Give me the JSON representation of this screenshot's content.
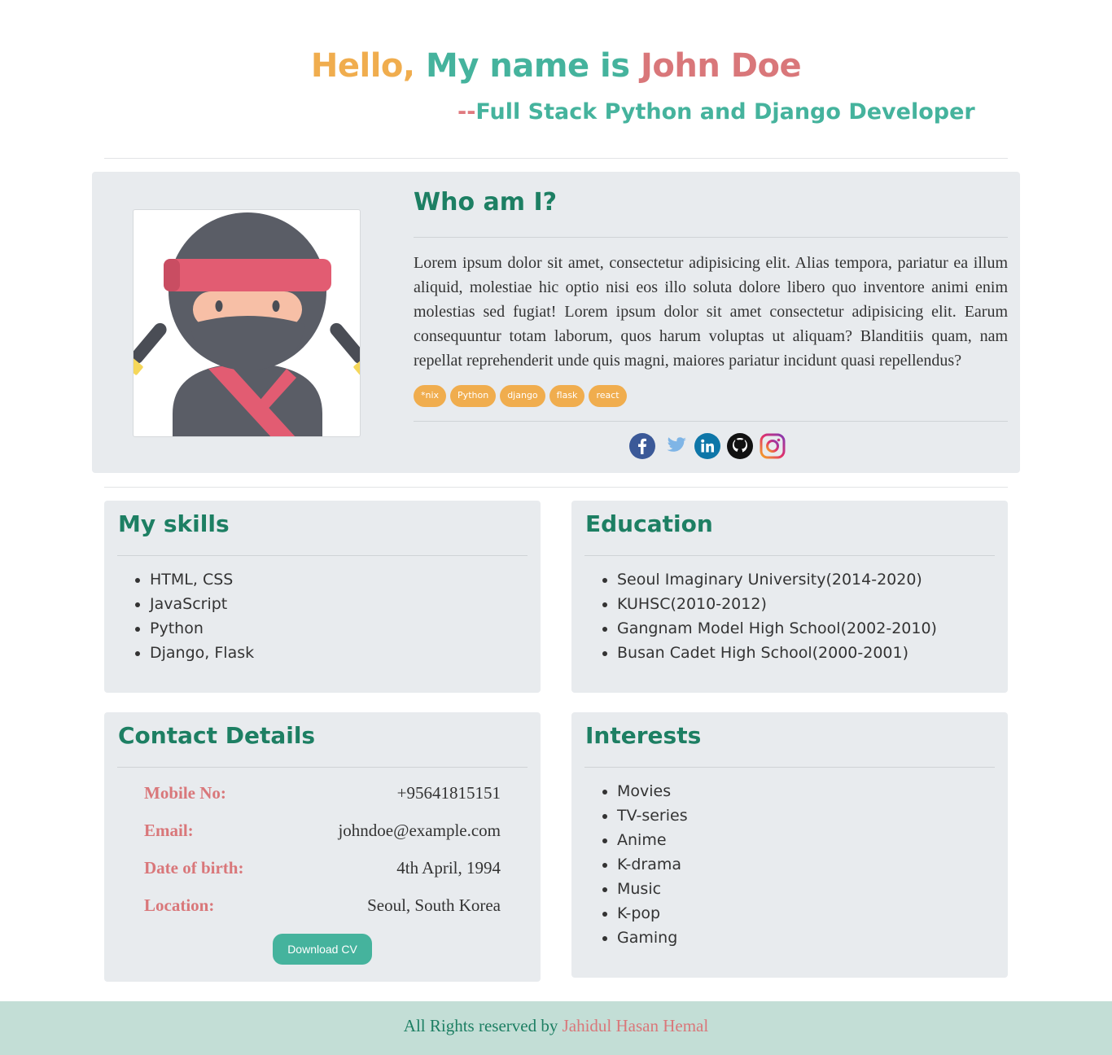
{
  "header": {
    "hello": "Hello,",
    "my_name_is": "My name is",
    "name": "John Doe",
    "dash": "--",
    "subtitle": "Full Stack Python and Django Developer"
  },
  "about": {
    "avatar": "ninja-avatar-icon",
    "title": "Who am I?",
    "text": "Lorem ipsum dolor sit amet, consectetur adipisicing elit. Alias tempora, pariatur ea illum aliquid, molestiae hic optio nisi eos illo soluta dolore libero quo inventore animi enim molestias sed fugiat! Lorem ipsum dolor sit amet consectetur adipisicing elit. Earum consequuntur totam laborum, quos harum voluptas ut aliquam? Blanditiis quam, nam repellat reprehenderit unde quis magni, maiores pariatur incidunt quasi repellendus?",
    "tags": [
      "*nix",
      "Python",
      "django",
      "flask",
      "react"
    ],
    "socials": [
      "facebook-icon",
      "twitter-icon",
      "linkedin-icon",
      "github-icon",
      "instagram-icon"
    ]
  },
  "skills": {
    "title": "My skills",
    "items": [
      "HTML, CSS",
      "JavaScript",
      "Python",
      "Django, Flask"
    ]
  },
  "education": {
    "title": "Education",
    "items": [
      "Seoul Imaginary University(2014-2020)",
      "KUHSC(2010-2012)",
      "Gangnam Model High School(2002-2010)",
      "Busan Cadet High School(2000-2001)"
    ]
  },
  "contact": {
    "title": "Contact Details",
    "rows": [
      {
        "label": "Mobile No:",
        "value": "+95641815151"
      },
      {
        "label": "Email:",
        "value": "johndoe@example.com"
      },
      {
        "label": "Date of birth:",
        "value": "4th April, 1994"
      },
      {
        "label": "Location:",
        "value": "Seoul, South Korea"
      }
    ],
    "button": "Download CV"
  },
  "interests": {
    "title": "Interests",
    "items": [
      "Movies",
      "TV-series",
      "Anime",
      "K-drama",
      "Music",
      "K-pop",
      "Gaming"
    ]
  },
  "footer": {
    "text": "All Rights reserved by",
    "author": "Jahidul Hasan Hemal"
  },
  "colors": {
    "accent_teal": "#45b39d",
    "heading_green": "#1d7f63",
    "accent_orange": "#f0ad4e",
    "accent_pink": "#d9777a",
    "card_bg": "#e8ebee",
    "footer_bg": "#c3ded6"
  }
}
